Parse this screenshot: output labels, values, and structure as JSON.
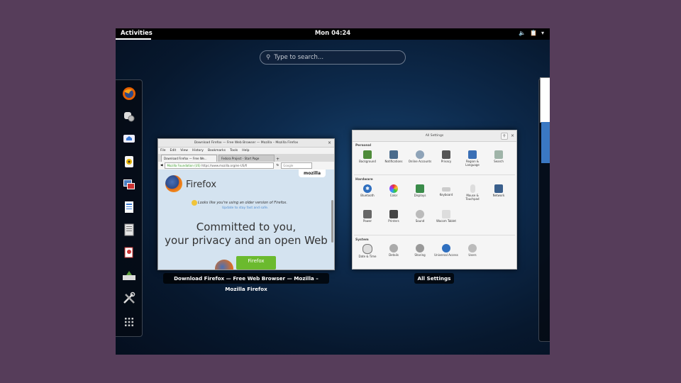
{
  "topbar": {
    "activities_label": "Activities",
    "clock": "Mon 04:24",
    "icons": [
      "volume-icon",
      "clipboard-icon",
      "chevron-down-icon"
    ]
  },
  "search": {
    "placeholder": "Type to search..."
  },
  "dash": {
    "apps": [
      {
        "name": "firefox",
        "icon": "firefox-icon"
      },
      {
        "name": "empathy",
        "icon": "chat-icon"
      },
      {
        "name": "evolution",
        "icon": "mail-icon"
      },
      {
        "name": "rhythmbox",
        "icon": "music-icon"
      },
      {
        "name": "shotwell",
        "icon": "photos-icon"
      },
      {
        "name": "documents",
        "icon": "document-icon"
      },
      {
        "name": "files",
        "icon": "files-icon"
      },
      {
        "name": "software",
        "icon": "software-icon"
      },
      {
        "name": "disk-usage",
        "icon": "disk-icon"
      },
      {
        "name": "settings-tools",
        "icon": "tools-icon"
      },
      {
        "name": "show-applications",
        "icon": "grid-icon"
      }
    ]
  },
  "windows": {
    "firefox": {
      "caption": "Download Firefox — Free Web Browser — Mozilla – Mozilla Firefox",
      "titlebar": "Download Firefox — Free Web Browser — Mozilla – Mozilla Firefox",
      "menu": [
        "File",
        "Edit",
        "View",
        "History",
        "Bookmarks",
        "Tools",
        "Help"
      ],
      "tab1": "Download Firefox — Free We...",
      "tab2": "Fedora Project - Start Page",
      "url_secure": "Mozilla Foundation (US)",
      "url": "https://www.mozilla.org/en-US/fi",
      "search_engine": "Google",
      "page": {
        "mozilla": "mozilla",
        "brand": "Firefox",
        "older_notice": "Looks like you're using an older version of Firefox.",
        "update_link": "Update to stay fast and safe.",
        "headline1": "Committed to you,",
        "headline2": "your privacy and an open Web",
        "download_btn": "Firefox"
      }
    },
    "settings": {
      "caption": "All Settings",
      "title": "All Settings",
      "personal_label": "Personal",
      "hardware_label": "Hardware",
      "system_label": "System",
      "personal": [
        "Background",
        "Notifications",
        "Online Accounts",
        "Privacy",
        "Region & Language",
        "Search"
      ],
      "hardware_row1": [
        "Bluetooth",
        "Color",
        "Displays",
        "Keyboard",
        "Mouse & Touchpad",
        "Network"
      ],
      "hardware_row2": [
        "Power",
        "Printers",
        "Sound",
        "Wacom Tablet"
      ],
      "system": [
        "Date & Time",
        "Details",
        "Sharing",
        "Universal Access",
        "Users"
      ]
    }
  }
}
